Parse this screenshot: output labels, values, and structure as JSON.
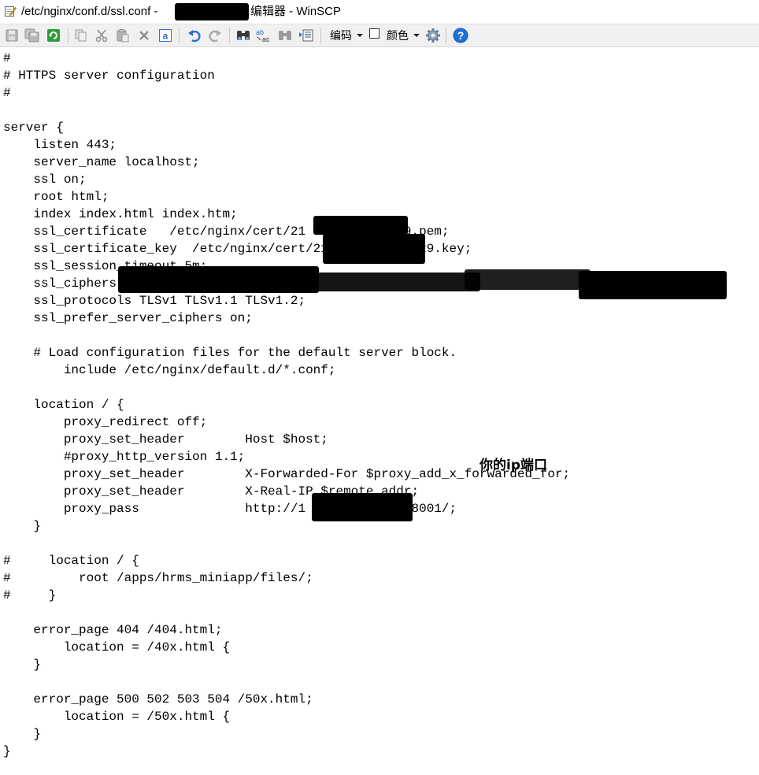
{
  "window": {
    "title_path": "/etc/nginx/conf.d/ssl.conf - ",
    "title_suffix": "编辑器 - WinSCP"
  },
  "toolbar": {
    "icons": [
      "save-icon",
      "save-all-icon",
      "reload-icon",
      "copy-icon",
      "cut-icon",
      "paste-icon",
      "delete-icon",
      "select-all-icon",
      "undo-icon",
      "redo-icon",
      "find-icon",
      "replace-icon",
      "find-next-icon",
      "goto-line-icon",
      "settings-icon",
      "help-icon"
    ],
    "encoding_label": "编码",
    "color_label": "颜色"
  },
  "editor": {
    "lines": [
      "#",
      "# HTTPS server configuration",
      "#",
      "",
      "server {",
      "    listen 443;",
      "    server_name localhost;",
      "    ssl on;",
      "    root html;",
      "    index index.html index.htm;",
      "    ssl_certificate   /etc/nginx/cert/21           229.pem;",
      "    ssl_certificate_key  /etc/nginx/cert/21           229.key;",
      "    ssl_session_timeout 5m;",
      "    ssl_ciphers                                                                         RC4;",
      "    ssl_protocols TLSv1 TLSv1.1 TLSv1.2;",
      "    ssl_prefer_server_ciphers on;",
      "",
      "    # Load configuration files for the default server block.",
      "        include /etc/nginx/default.d/*.conf;",
      "",
      "    location / {",
      "        proxy_redirect off;",
      "        proxy_set_header        Host $host;",
      "        #proxy_http_version 1.1;",
      "        proxy_set_header        X-Forwarded-For $proxy_add_x_forwarded_for;",
      "        proxy_set_header        X-Real-IP $remote_addr;",
      "        proxy_pass              http://1       .69.79:8001/;",
      "    }",
      "",
      "#     location / {",
      "#         root /apps/hrms_miniapp/files/;",
      "#     }",
      "",
      "    error_page 404 /404.html;",
      "        location = /40x.html {",
      "    }",
      "",
      "    error_page 500 502 503 504 /50x.html;",
      "        location = /50x.html {",
      "    }",
      "}"
    ],
    "annotation": "你的ip端口"
  },
  "colors": {
    "help_blue": "#1e6fd8",
    "reload_green": "#2e9b3a",
    "undo_blue": "#2f6fc9"
  }
}
